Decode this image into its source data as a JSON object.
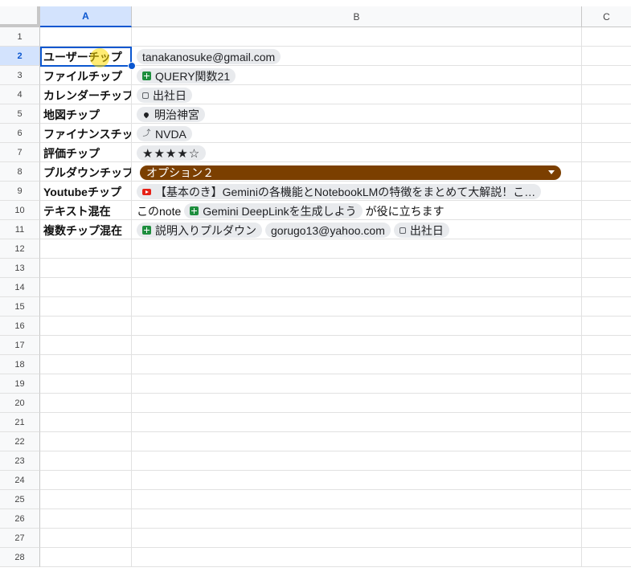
{
  "columns": [
    "A",
    "B",
    "C"
  ],
  "rows": [
    "1",
    "2",
    "3",
    "4",
    "5",
    "6",
    "7",
    "8",
    "9",
    "10",
    "11",
    "12",
    "13",
    "14",
    "15",
    "16",
    "17",
    "18",
    "19",
    "20",
    "21",
    "22",
    "23",
    "24",
    "25",
    "26",
    "27",
    "28"
  ],
  "labels": {
    "r2": "ユーザーチップ",
    "r3": "ファイルチップ",
    "r4": "カレンダーチップ",
    "r5": "地図チップ",
    "r6": "ファイナンスチップ",
    "r7": "評価チップ",
    "r8": "プルダウンチップ",
    "r9": "Youtubeチップ",
    "r10": "テキスト混在",
    "r11": "複数チップ混在"
  },
  "values": {
    "user_chip": "tanakanosuke@gmail.com",
    "file_chip": "QUERY関数21",
    "calendar_chip": "出社日",
    "map_chip": "明治神宮",
    "finance_chip": "NVDA",
    "rating": "★★★★☆",
    "rating_value": 4,
    "dropdown_value": "オプション２",
    "youtube_chip": "【基本のき】Geminiの各機能とNotebookLMの特徴をまとめて大解説！こ…",
    "text_prefix": "このnote",
    "text_chip": "Gemini DeepLinkを生成しよう",
    "text_suffix": "が役に立ちます",
    "multi_chip1": "説明入りプルダウン",
    "multi_chip2": "gorugo13@yahoo.com",
    "multi_chip3": "出社日"
  },
  "colors": {
    "selection": "#0b57d0",
    "dropdown_bg": "#7b3f00",
    "sheet_icon": "#1e8e3e",
    "youtube_icon": "#e62117"
  }
}
